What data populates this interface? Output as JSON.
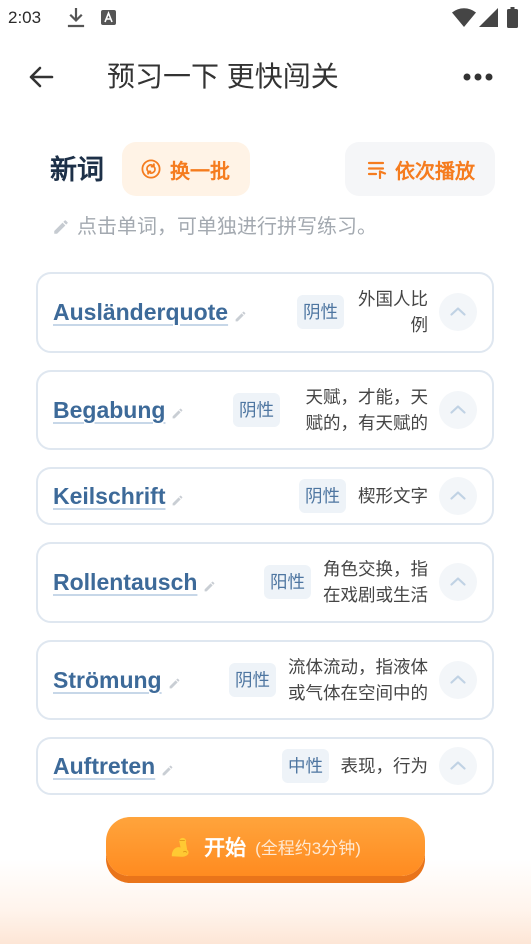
{
  "status_bar": {
    "time": "2:03",
    "notification_icons": [
      "download-icon",
      "text-a-icon"
    ],
    "system_icons": [
      "wifi-icon",
      "cellular-signal-icon",
      "battery-icon"
    ]
  },
  "header": {
    "back_icon": "arrow-left-icon",
    "title": "预习一下 更快闯关",
    "more_icon": "more-horizontal-icon"
  },
  "new_words": {
    "title": "新词",
    "shuffle_button": {
      "icon": "refresh-circle-icon",
      "label": "换一批"
    },
    "play_all_button": {
      "icon": "playlist-play-icon",
      "label": "依次播放"
    }
  },
  "hint": {
    "icon": "pencil-icon",
    "text": "点击单词，可单独进行拼写练习。"
  },
  "words": [
    {
      "word": "Ausländerquote",
      "gender": "阴性",
      "meaning": "外国人比例"
    },
    {
      "word": "Begabung",
      "gender": "阴性",
      "meaning": "天赋，才能，天赋的，有天赋的"
    },
    {
      "word": "Keilschrift",
      "gender": "阴性",
      "meaning": "楔形文字"
    },
    {
      "word": "Rollentausch",
      "gender": "阳性",
      "meaning": "角色交换，指在戏剧或生活"
    },
    {
      "word": "Strömung",
      "gender": "阴性",
      "meaning": "流体流动，指液体或气体在空间中的"
    },
    {
      "word": "Auftreten",
      "gender": "中性",
      "meaning": "表现，行为"
    }
  ],
  "word_card_icons": {
    "edit": "pencil-icon",
    "expand": "chevron-up-icon"
  },
  "start_button": {
    "icon": "flexed-biceps-icon",
    "label": "开始",
    "duration_note": "(全程约3分钟)"
  },
  "colors": {
    "accent": "#f57c1f",
    "word": "#3d6a99",
    "badge_bg": "#eef3f8",
    "badge_text": "#4e76a1",
    "button_top": "#ffa43c",
    "button_bottom": "#ff8b20",
    "button_edge": "#e9741a"
  }
}
